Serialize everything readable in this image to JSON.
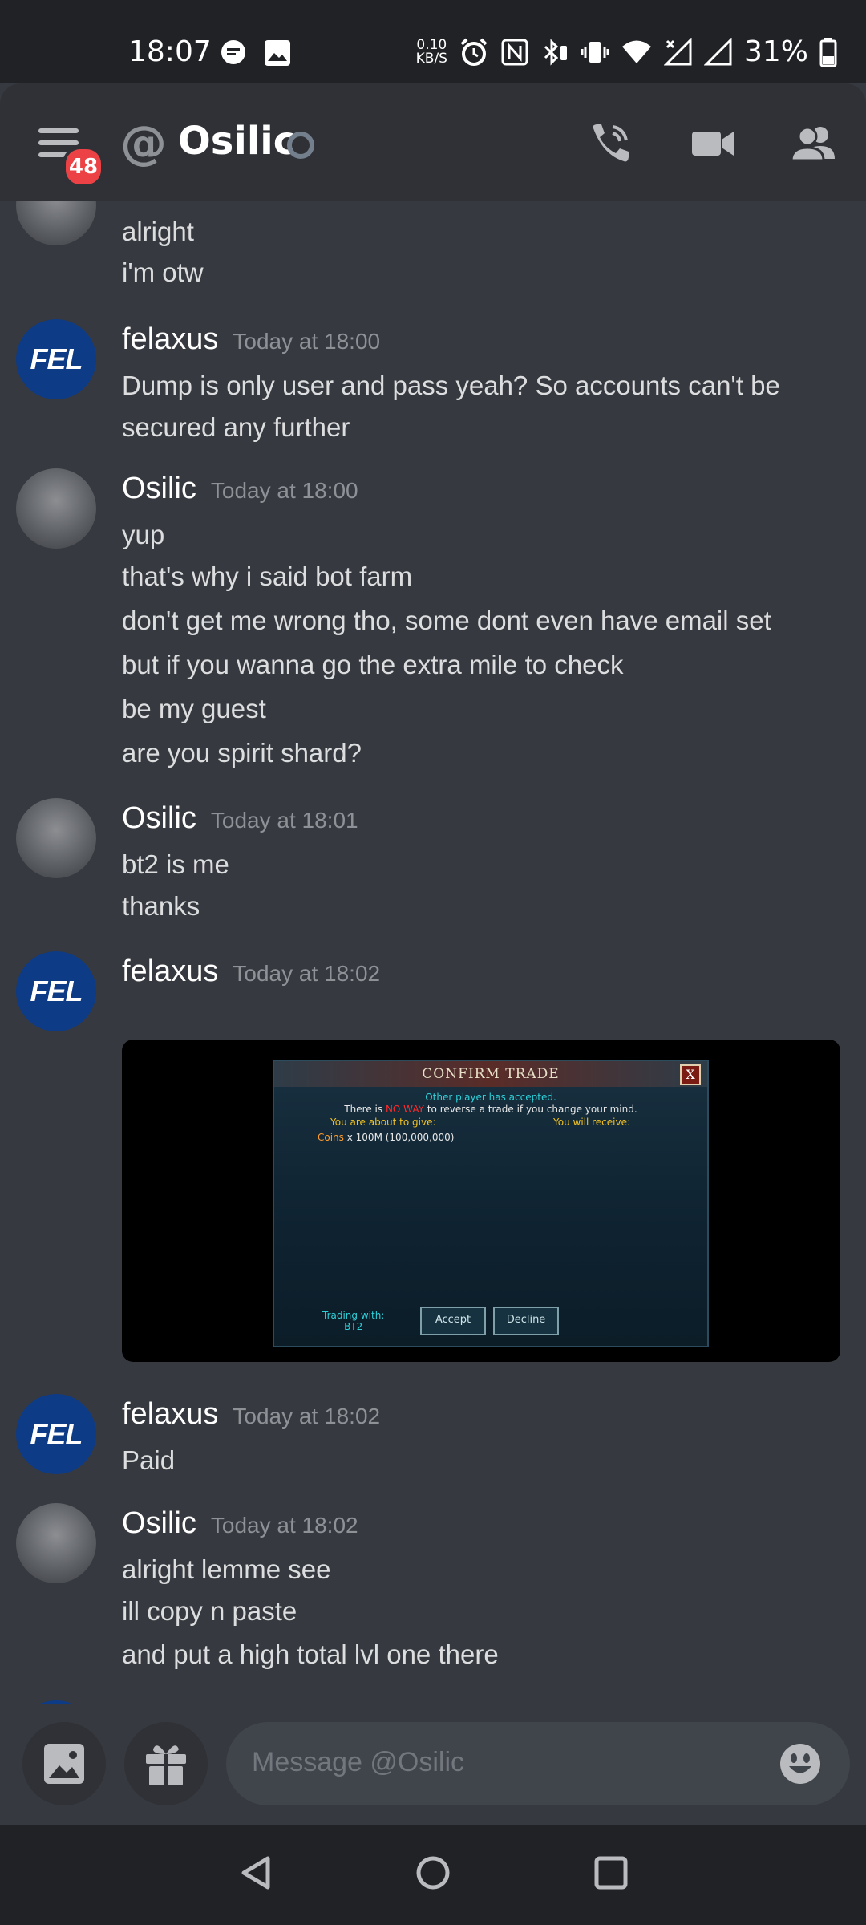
{
  "status_bar": {
    "time": "18:07",
    "net_speed": "0.10",
    "net_unit": "KB/S",
    "battery": "31%"
  },
  "header": {
    "notification_badge": "48",
    "at_symbol": "@",
    "channel_name": "Osilic"
  },
  "messages": [
    {
      "lines": [
        "alright",
        "i'm otw"
      ]
    },
    {
      "author": "felaxus",
      "timestamp": "Today at 18:00",
      "lines": [
        "Dump is only user and pass yeah? So accounts can't be",
        "secured any further"
      ]
    },
    {
      "author": "Osilic",
      "timestamp": "Today at 18:00",
      "lines": [
        "yup",
        "that's why i said bot farm",
        "don't get me wrong tho, some dont even have email set",
        "but if you wanna go the extra mile to check",
        "be my guest",
        "are you spirit shard?"
      ]
    },
    {
      "author": "Osilic",
      "timestamp": "Today at 18:01",
      "lines": [
        "bt2 is me",
        "thanks"
      ]
    },
    {
      "author": "felaxus",
      "timestamp": "Today at 18:02",
      "lines": []
    },
    {
      "author": "felaxus",
      "timestamp": "Today at 18:02",
      "lines": [
        "Paid"
      ]
    },
    {
      "author": "Osilic",
      "timestamp": "Today at 18:02",
      "lines": [
        "alright lemme see",
        "ill copy n paste",
        "and put a high total lvl one there"
      ]
    }
  ],
  "avatar_text": {
    "felaxus": "FEL"
  },
  "trade_window": {
    "title": "CONFIRM TRADE",
    "close": "X",
    "accepted": "Other player has accepted.",
    "warn_pre": "There is",
    "warn_bold": "NO WAY",
    "warn_post": "to reverse a trade if you change your mind.",
    "give_label": "You are about to give:",
    "receive_label": "You will receive:",
    "item_name": "Coins",
    "item_amount": "x 100M (100,000,000)",
    "trading_with_label": "Trading with:",
    "trading_with_name": "BT2",
    "accept": "Accept",
    "decline": "Decline"
  },
  "composer": {
    "placeholder": "Message @Osilic"
  },
  "colors": {
    "background": "#36393f",
    "header": "#2f3136",
    "badge": "#ed4245",
    "fel_avatar": "#0e3b86"
  }
}
